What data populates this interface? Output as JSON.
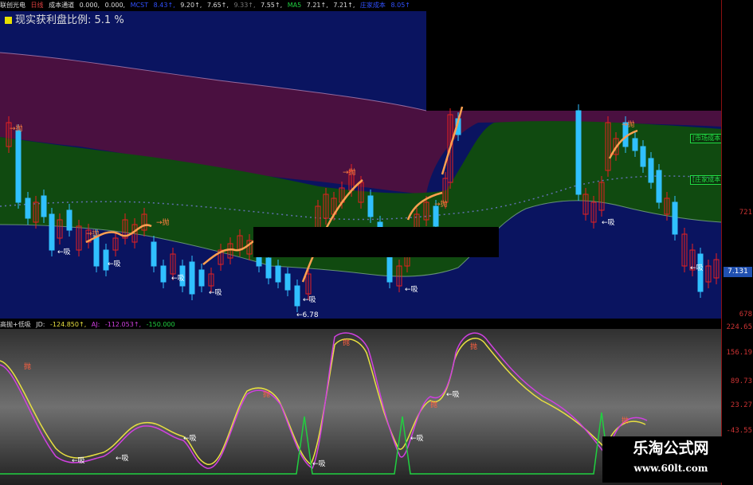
{
  "topbar": {
    "stock_name": "联创光电",
    "period": "日线",
    "indicator": "成本通道",
    "v1": "0.000,",
    "v2": "0.000,",
    "m_label": "MCST",
    "m_value": "8.43↑,",
    "v3": "9.20↑,",
    "v4": "7.65↑,",
    "v5": "9.33↑,",
    "v6": "7.55↑,",
    "ma5_label": "MA5",
    "ma5_value": "7.21↑,",
    "v7": "7.21↑,",
    "zhuang_label": "庄家成本",
    "zhuang_value": "8.05↑"
  },
  "profit_label": "现实获利盘比例: 5.1 %",
  "legend": {
    "market_cost": "[市场成本]",
    "dealer_cost": "[庄家成本]"
  },
  "annotations": {
    "sell": "抛",
    "buy": "吸",
    "low_price": "6.78"
  },
  "osc_header": {
    "name": "高抛+低吸",
    "jd_label": "JD:",
    "jd_value": "-124.850↑,",
    "aj_label": "AJ:",
    "aj_value": "-112.053↑,",
    "v": "-150.000"
  },
  "axis": {
    "price_labels": [
      "721",
      "678"
    ],
    "price_tag": "7.131",
    "osc_labels": [
      "224.65",
      "156.19",
      "89.73",
      "23.27",
      "-43.55"
    ]
  },
  "watermark": {
    "title": "乐淘公式网",
    "url": "www.60lt.com"
  },
  "colors": {
    "navy_bg": "#0a1460",
    "purple_band": "#4a1040",
    "green_band": "#104a10",
    "candle_up": "#e82020",
    "candle_down": "#30c0ff",
    "osc_bg": "#606060",
    "line_yellow": "#e8e040",
    "line_magenta": "#d040e0",
    "spike_green": "#20d040"
  }
}
